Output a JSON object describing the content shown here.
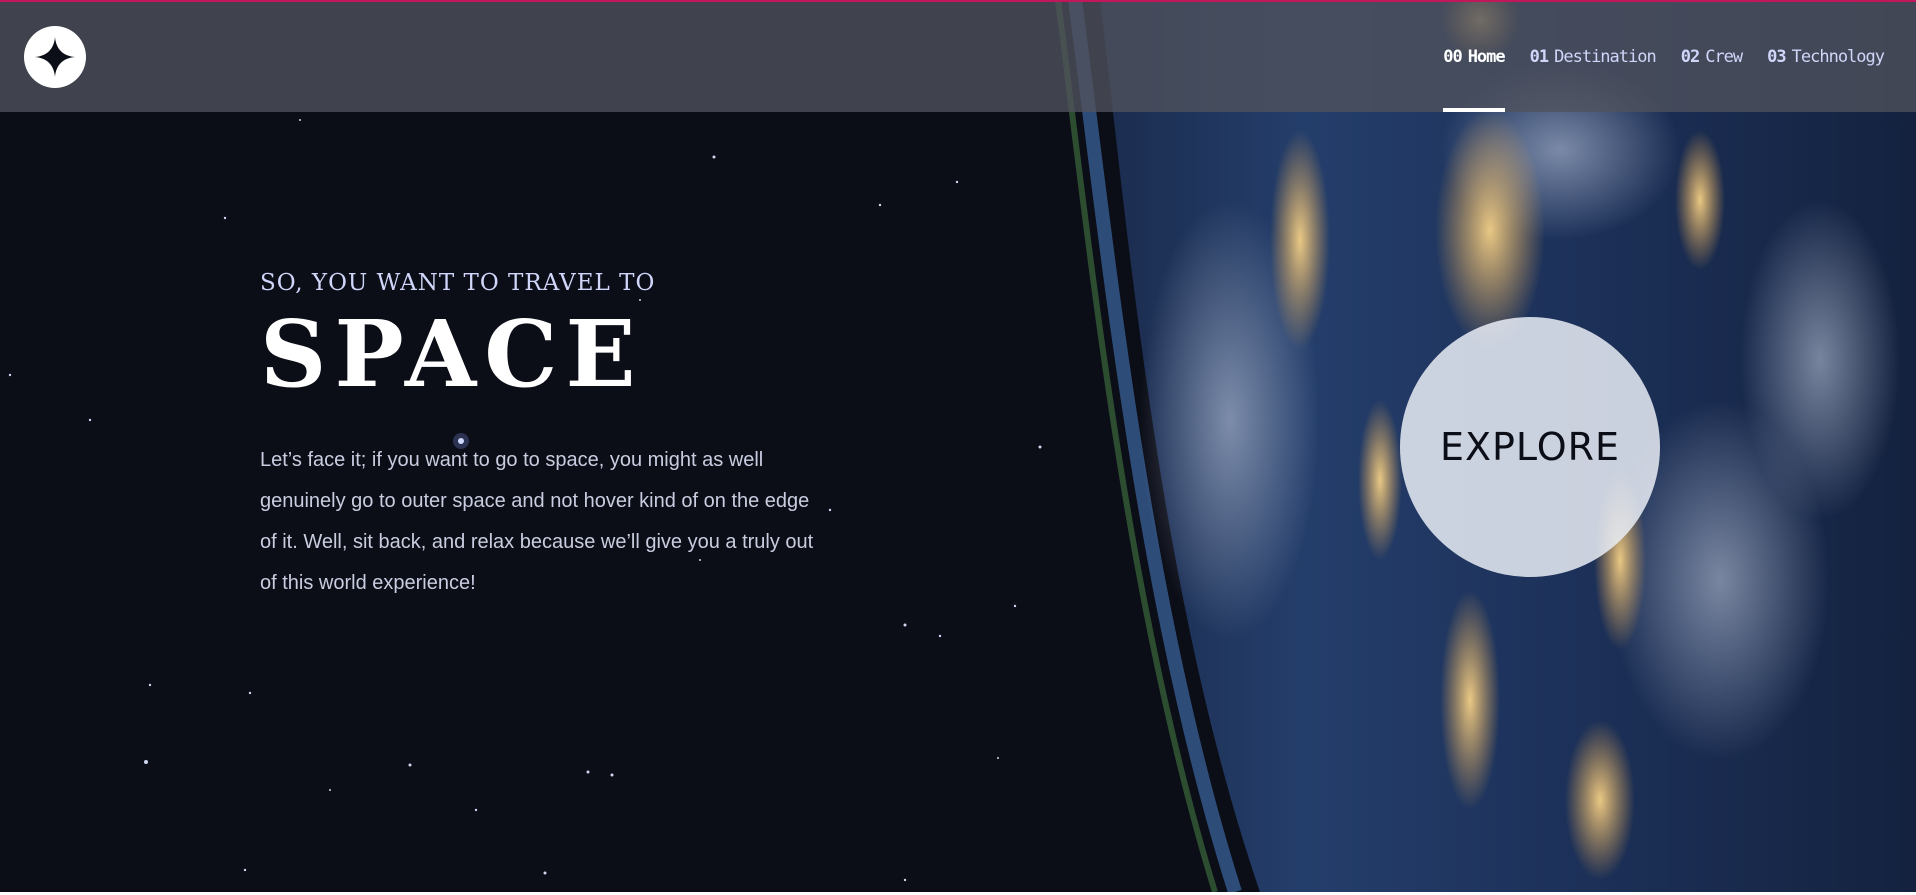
{
  "header": {
    "logo_icon": "star-logo-icon",
    "nav": [
      {
        "num": "00",
        "label": "Home",
        "active": true
      },
      {
        "num": "01",
        "label": "Destination",
        "active": false
      },
      {
        "num": "02",
        "label": "Crew",
        "active": false
      },
      {
        "num": "03",
        "label": "Technology",
        "active": false
      }
    ]
  },
  "hero": {
    "eyebrow": "SO, YOU WANT TO TRAVEL TO",
    "title": "SPACE",
    "description": "Let’s face it; if you want to go to space, you might as well genuinely go to outer space and not hover kind of on the edge of it. Well, sit back, and relax because we’ll give you a truly out of this world experience!"
  },
  "explore_button": {
    "label": "EXPLORE"
  },
  "colors": {
    "background": "#0b0d17",
    "accent_line": "#c2185b",
    "text_light": "#d0d6f9",
    "white": "#ffffff"
  }
}
